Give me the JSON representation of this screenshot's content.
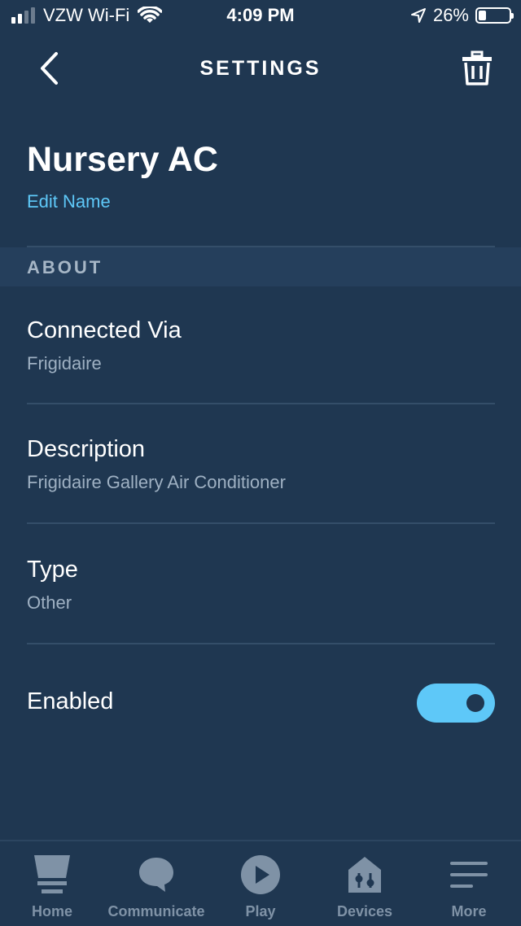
{
  "status_bar": {
    "carrier": "VZW Wi-Fi",
    "time": "4:09 PM",
    "battery": "26%",
    "battery_level": 0.26,
    "signal_bars": 2
  },
  "nav": {
    "title": "SETTINGS",
    "back_icon": "chevron-left-icon",
    "delete_icon": "trash-icon"
  },
  "device": {
    "name": "Nursery AC",
    "edit_label": "Edit Name"
  },
  "about": {
    "header": "ABOUT",
    "connected_via": {
      "title": "Connected Via",
      "value": "Frigidaire"
    },
    "description": {
      "title": "Description",
      "value": "Frigidaire Gallery Air Conditioner"
    },
    "type": {
      "title": "Type",
      "value": "Other"
    },
    "enabled": {
      "title": "Enabled",
      "on": true
    }
  },
  "tabs": [
    {
      "label": "Home",
      "icon": "home-icon"
    },
    {
      "label": "Communicate",
      "icon": "communicate-icon"
    },
    {
      "label": "Play",
      "icon": "play-icon"
    },
    {
      "label": "Devices",
      "icon": "devices-icon"
    },
    {
      "label": "More",
      "icon": "more-icon"
    }
  ],
  "colors": {
    "background": "#1f3751",
    "section_header": "#253f5c",
    "accent": "#5ec8f8",
    "subtext": "#9fb1c3",
    "tab_inactive": "#7f92a6"
  }
}
